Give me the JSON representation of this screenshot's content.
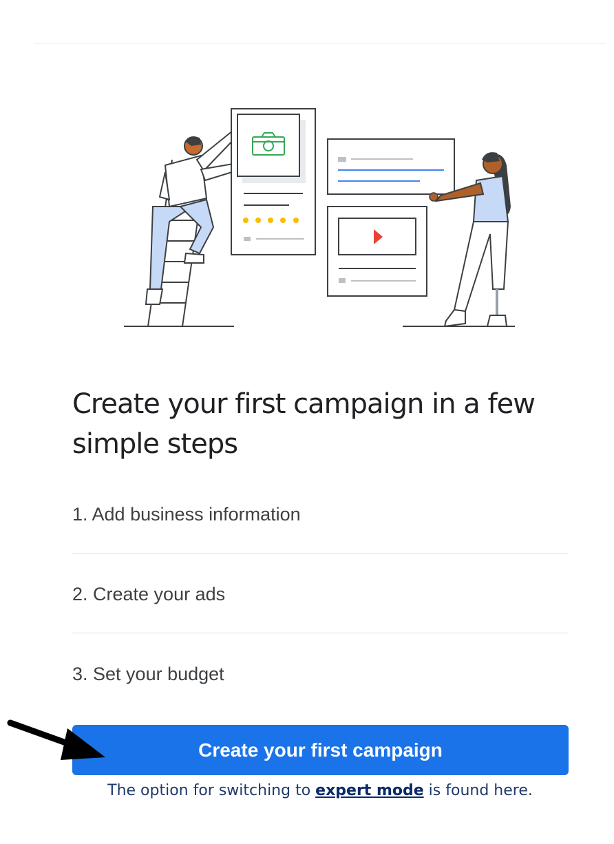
{
  "hero": {
    "illustration": "people-building-campaign-illustration"
  },
  "main": {
    "title": "Create your first campaign in a few simple steps",
    "steps": [
      "1. Add business information",
      "2. Create your ads",
      "3. Set your budget"
    ],
    "cta_label": "Create your first campaign"
  },
  "annotation": {
    "caption_before": "The option for switching to ",
    "caption_link": "expert mode",
    "caption_after": " is found here.",
    "arrow_icon": "arrow-right-down-icon"
  },
  "colors": {
    "primary_blue": "#1a73e8",
    "caption_blue": "#1f3a6b",
    "camera_green": "#34a853",
    "play_red": "#ea4335",
    "dots_yellow": "#fbbc04"
  }
}
